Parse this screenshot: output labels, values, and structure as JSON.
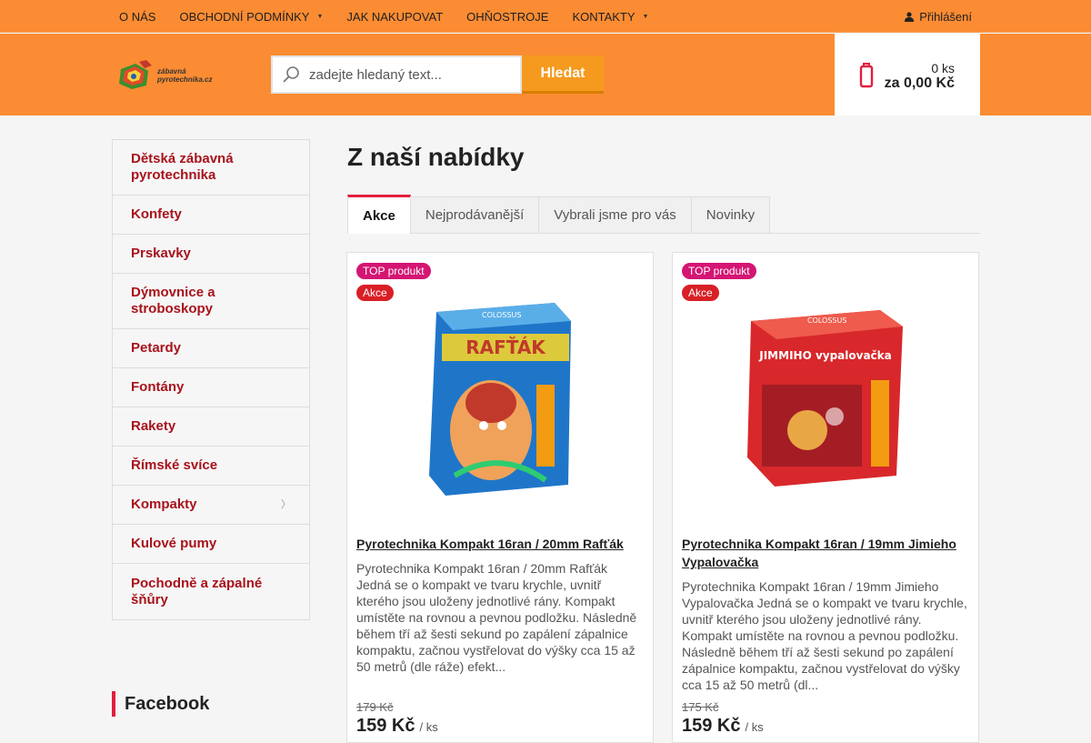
{
  "topnav": {
    "items": [
      {
        "label": "O nás"
      },
      {
        "label": "Obchodní podmínky",
        "has_dropdown": true
      },
      {
        "label": "Jak nakupovat"
      },
      {
        "label": "Ohňostroje"
      },
      {
        "label": "Kontakty",
        "has_dropdown": true
      }
    ],
    "login_label": "Přihlášení",
    "caret": "▼"
  },
  "header": {
    "logo_text_1": "zábavná",
    "logo_text_2": "pyrotechnika.cz",
    "search_placeholder": "zadejte hledaný text...",
    "search_button": "Hledat",
    "cart_qty": "0 ks",
    "cart_total": "za 0,00 Kč"
  },
  "sidebar": {
    "categories": [
      {
        "label": "Dětská zábavná pyrotechnika",
        "lines": 2
      },
      {
        "label": "Konfety",
        "lines": 1
      },
      {
        "label": "Prskavky",
        "lines": 1
      },
      {
        "label": "Dýmovnice a stroboskopy",
        "lines": 2
      },
      {
        "label": "Petardy",
        "lines": 1
      },
      {
        "label": "Fontány",
        "lines": 1
      },
      {
        "label": "Rakety",
        "lines": 1
      },
      {
        "label": "Římské svíce",
        "lines": 1
      },
      {
        "label": "Kompakty",
        "lines": 1,
        "has_submenu": true
      },
      {
        "label": "Kulové pumy",
        "lines": 1
      },
      {
        "label": "Pochodně a zápalné šňůry",
        "lines": 2
      }
    ],
    "chevron": "〉",
    "facebook_title": "Facebook"
  },
  "main": {
    "title": "Z naší nabídky",
    "tabs": [
      {
        "label": "Akce",
        "active": true
      },
      {
        "label": "Nejprodávanější",
        "active": false
      },
      {
        "label": "Vybrali jsme pro vás",
        "active": false
      },
      {
        "label": "Novinky",
        "active": false
      }
    ],
    "products": [
      {
        "badge_top": "TOP produkt",
        "badge_sale": "Akce",
        "image_label": "RAFŤÁK",
        "brand": "COLOSSUS",
        "name": "Pyrotechnika Kompakt 16ran / 20mm Rafťák",
        "description": "Pyrotechnika Kompakt 16ran / 20mm Rafťák Jedná se o kompakt ve tvaru krychle, uvnitř kterého jsou uloženy jednotlivé rány. Kompakt umístěte na rovnou a pevnou podložku. Následně během tří až šesti sekund po zapálení zápalnice kompaktu,  začnou vystřelovat do výšky cca 15 až 50 metrů (dle ráže) efekt...",
        "old_price": "179 Kč",
        "price": "159 Kč",
        "unit": "/ ks"
      },
      {
        "badge_top": "TOP produkt",
        "badge_sale": "Akce",
        "image_label": "JIMMIHO vypalovačka",
        "brand": "COLOSSUS",
        "name": "Pyrotechnika Kompakt 16ran / 19mm Jimieho Vypalovačka",
        "description": "Pyrotechnika Kompakt 16ran / 19mm Jimieho Vypalovačka Jedná se o kompakt ve tvaru krychle, uvnitř kterého jsou uloženy jednotlivé rány. Kompakt umístěte na rovnou a pevnou podložku. Následně během tří až šesti sekund po zapálení zápalnice kompaktu,  začnou vystřelovat do výšky cca 15 až 50 metrů (dl...",
        "old_price": "175 Kč",
        "price": "159 Kč",
        "unit": "/ ks"
      }
    ]
  },
  "colors": {
    "header_orange": "#fb8c33",
    "accent_red": "#e31e3c",
    "category_red": "#a8121b",
    "top_badge": "#d41573",
    "search_button": "#f59a1f"
  }
}
